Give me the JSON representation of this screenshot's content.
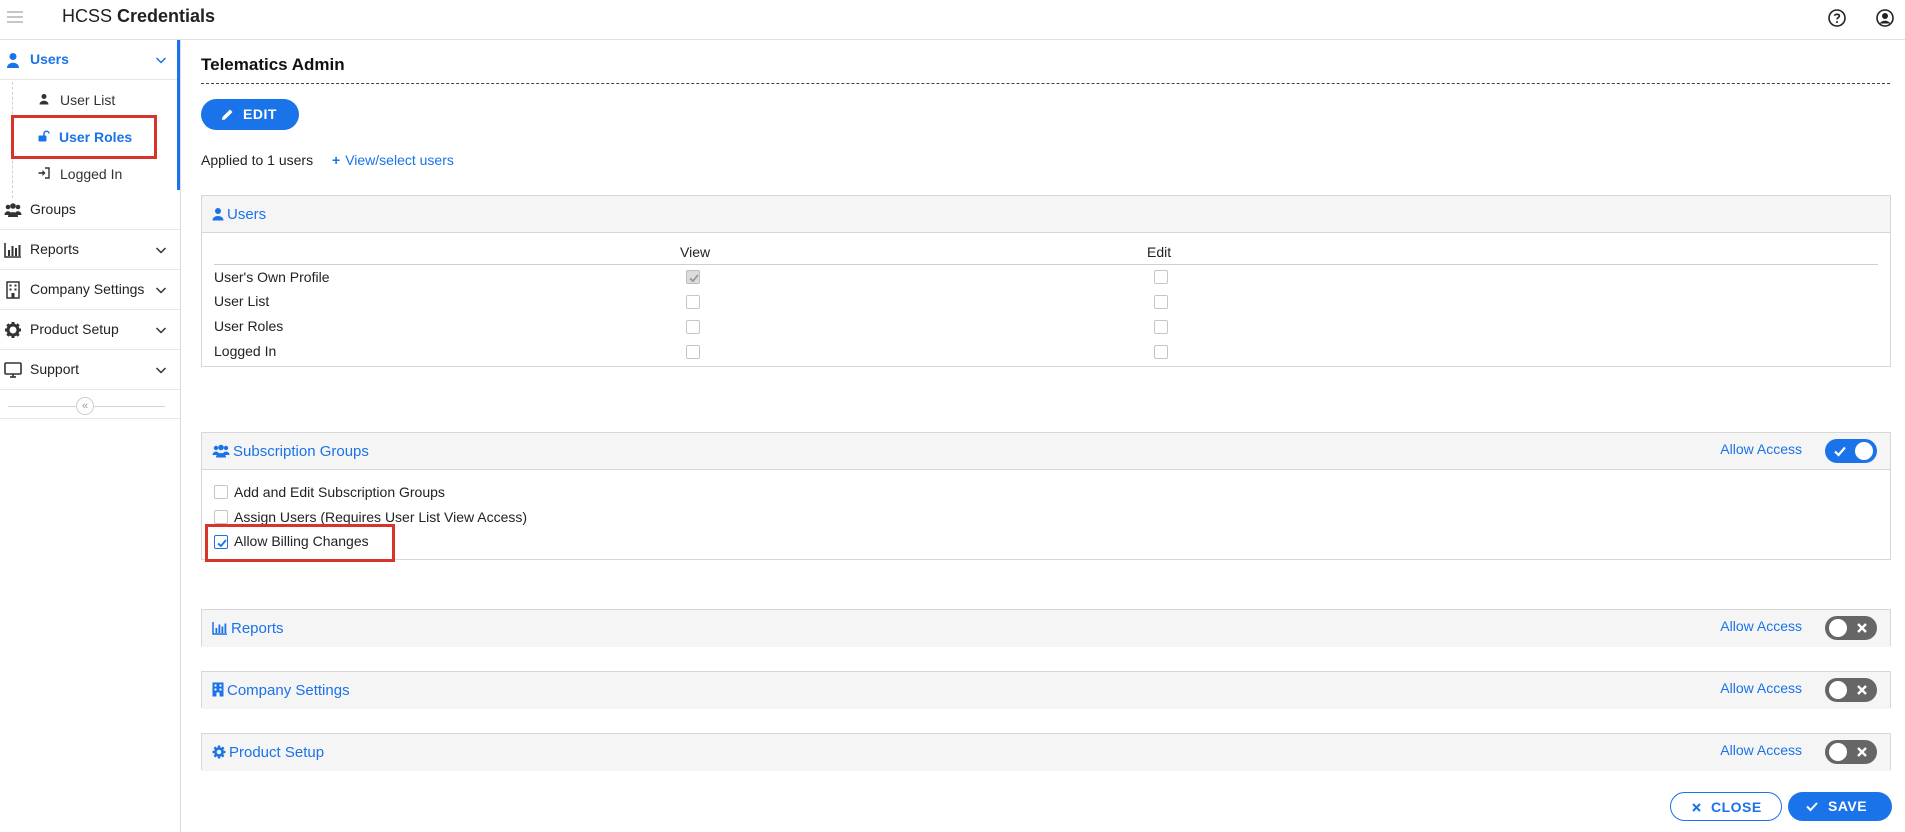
{
  "app": {
    "title_regular": "HCSS",
    "title_bold": "Credentials",
    "icons": {
      "menu": "hamburger-icon",
      "help": "help-circle-icon",
      "account": "user-circle-icon"
    }
  },
  "sidebar": {
    "items": [
      {
        "label": "Users",
        "icon": "user-icon",
        "expanded": true,
        "active": true
      },
      {
        "label": "Groups",
        "icon": "users-group-icon",
        "expanded": false
      },
      {
        "label": "Reports",
        "icon": "bar-chart-icon",
        "expanded": false
      },
      {
        "label": "Company Settings",
        "icon": "building-icon",
        "expanded": false
      },
      {
        "label": "Product Setup",
        "icon": "gear-icon",
        "expanded": false
      },
      {
        "label": "Support",
        "icon": "monitor-icon",
        "expanded": false
      }
    ],
    "subitems": [
      {
        "label": "User List",
        "icon": "user-icon"
      },
      {
        "label": "User Roles",
        "icon": "unlock-icon",
        "current": true
      },
      {
        "label": "Logged In",
        "icon": "sign-in-icon"
      }
    ],
    "collapse_glyph": "«"
  },
  "main": {
    "title": "Telematics Admin",
    "edit_label": "EDIT",
    "applied_text": "Applied to 1 users",
    "view_users_plus": "+",
    "view_users_label": "View/select users",
    "users_panel": {
      "title": "Users",
      "columns": [
        "View",
        "Edit"
      ],
      "rows": [
        {
          "label": "User's Own Profile",
          "view": "checked-disabled",
          "edit": "unchecked"
        },
        {
          "label": "User List",
          "view": "unchecked",
          "edit": "unchecked"
        },
        {
          "label": "User Roles",
          "view": "unchecked",
          "edit": "unchecked"
        },
        {
          "label": "Logged In",
          "view": "unchecked",
          "edit": "unchecked"
        }
      ]
    },
    "subscription_panel": {
      "title": "Subscription Groups",
      "allow_label": "Allow Access",
      "allow_on": true,
      "options": [
        {
          "label": "Add and Edit Subscription Groups",
          "checked": false
        },
        {
          "label": "Assign Users (Requires User List View Access)",
          "checked": false
        },
        {
          "label": "Allow Billing Changes",
          "checked": true
        }
      ]
    },
    "collapsed_panels": [
      {
        "title": "Reports",
        "icon": "bar-chart-icon",
        "allow_label": "Allow Access",
        "allow_on": false
      },
      {
        "title": "Company Settings",
        "icon": "building-icon",
        "allow_label": "Allow Access",
        "allow_on": false
      },
      {
        "title": "Product Setup",
        "icon": "gear-icon",
        "allow_label": "Allow Access",
        "allow_on": false
      }
    ],
    "close_label": "CLOSE",
    "save_label": "SAVE"
  },
  "colors": {
    "accent": "#1a73e8",
    "highlight": "#d9342b",
    "toggle_off": "#666666"
  }
}
